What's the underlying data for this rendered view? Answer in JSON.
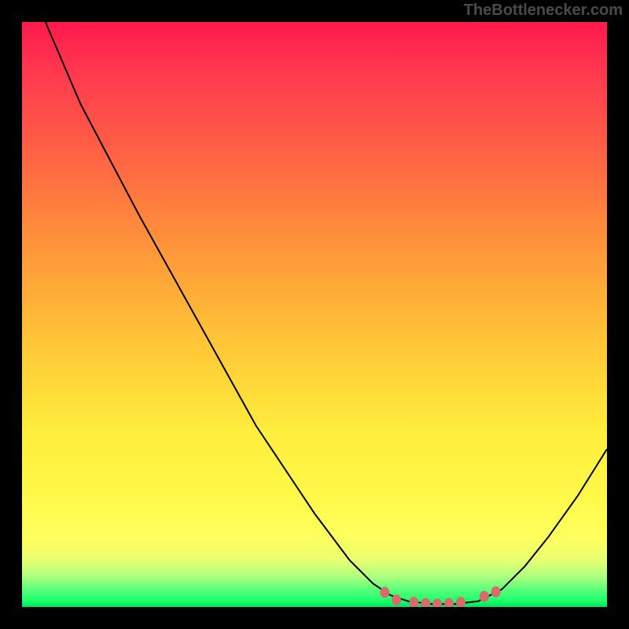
{
  "watermark": "TheBottlenecker.com",
  "chart_data": {
    "type": "line",
    "title": "",
    "xlabel": "",
    "ylabel": "",
    "x_range": [
      0,
      100
    ],
    "y_range": [
      0,
      100
    ],
    "description": "Bottleneck curve over gradient background (red=high bottleneck, green=low). Curve shows minimum region in green band.",
    "curve_points": [
      {
        "x": 4,
        "y": 100
      },
      {
        "x": 10,
        "y": 86
      },
      {
        "x": 20,
        "y": 67
      },
      {
        "x": 30,
        "y": 49
      },
      {
        "x": 40,
        "y": 31
      },
      {
        "x": 50,
        "y": 16
      },
      {
        "x": 56,
        "y": 8
      },
      {
        "x": 60,
        "y": 4
      },
      {
        "x": 63,
        "y": 2
      },
      {
        "x": 66,
        "y": 1
      },
      {
        "x": 70,
        "y": 0.5
      },
      {
        "x": 74,
        "y": 0.5
      },
      {
        "x": 78,
        "y": 1
      },
      {
        "x": 82,
        "y": 3
      },
      {
        "x": 86,
        "y": 7
      },
      {
        "x": 90,
        "y": 12
      },
      {
        "x": 95,
        "y": 19
      },
      {
        "x": 100,
        "y": 27
      }
    ],
    "optimal_markers": [
      {
        "x": 62,
        "y": 2.5
      },
      {
        "x": 64,
        "y": 1.2
      },
      {
        "x": 67,
        "y": 0.8
      },
      {
        "x": 69,
        "y": 0.6
      },
      {
        "x": 71,
        "y": 0.5
      },
      {
        "x": 73,
        "y": 0.6
      },
      {
        "x": 75,
        "y": 0.8
      },
      {
        "x": 79,
        "y": 1.8
      },
      {
        "x": 81,
        "y": 2.6
      }
    ],
    "marker_color": "#d86b6b",
    "curve_color": "#000000",
    "gradient_stops": [
      {
        "pos": 0,
        "color": "#ff1a4d"
      },
      {
        "pos": 50,
        "color": "#ffb838"
      },
      {
        "pos": 85,
        "color": "#ffff5e"
      },
      {
        "pos": 100,
        "color": "#00e060"
      }
    ]
  }
}
